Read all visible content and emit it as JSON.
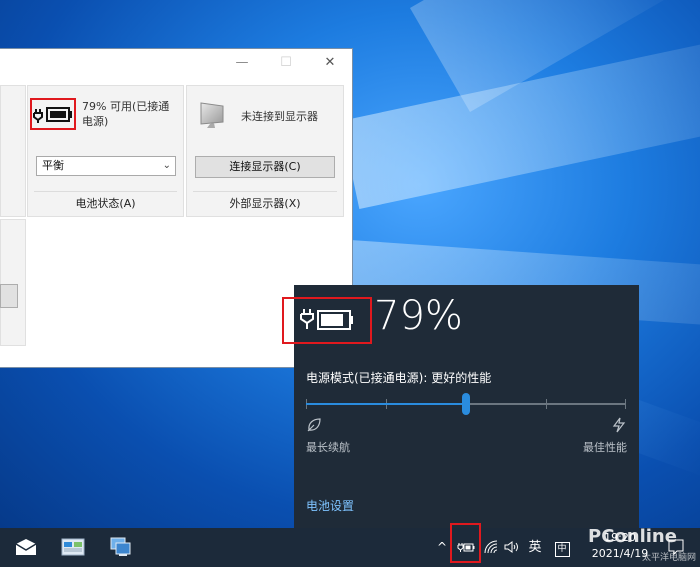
{
  "window": {
    "controls": {
      "minimize": "—",
      "maximize": "☐",
      "close": "✕"
    },
    "battery_tile": {
      "status_text": "79% 可用(已接通电源)",
      "plan_selected": "平衡",
      "caption": "电池状态(A)"
    },
    "display_tile": {
      "status_text": "未连接到显示器",
      "button_label": "连接显示器(C)",
      "caption": "外部显示器(X)"
    }
  },
  "flyout": {
    "percent": "79%",
    "mode_label": "电源模式(已接通电源): 更好的性能",
    "slider_value": 0.5,
    "min_label": "最长续航",
    "max_label": "最佳性能",
    "settings_link": "电池设置",
    "accent_color": "#2a8cde"
  },
  "taskbar": {
    "apps": [
      "mail-icon",
      "mobility-center-icon",
      "network-computer-icon"
    ],
    "tray": {
      "chevron": "^",
      "language": "英",
      "ime": "中"
    },
    "clock": {
      "time": "19:20",
      "date": "2021/4/19"
    }
  },
  "watermark": {
    "brand": "PConline",
    "subtitle": "太平洋电脑网"
  },
  "colors": {
    "highlight_border": "#e0191e",
    "flyout_bg": "#1f2b38",
    "taskbar_bg": "#1c2a3a"
  }
}
